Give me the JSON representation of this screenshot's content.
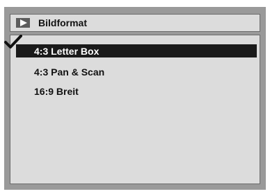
{
  "header": {
    "title": "Bildformat",
    "icon": "play-icon"
  },
  "options": [
    {
      "label": "4:3 Letter Box",
      "selected": true
    },
    {
      "label": "4:3 Pan & Scan",
      "selected": false
    },
    {
      "label": "16:9 Breit",
      "selected": false
    }
  ],
  "colors": {
    "background": "#9a9a9a",
    "panel": "#dcdcdc",
    "highlight": "#1a1a1a",
    "highlight_text": "#ffffff"
  }
}
